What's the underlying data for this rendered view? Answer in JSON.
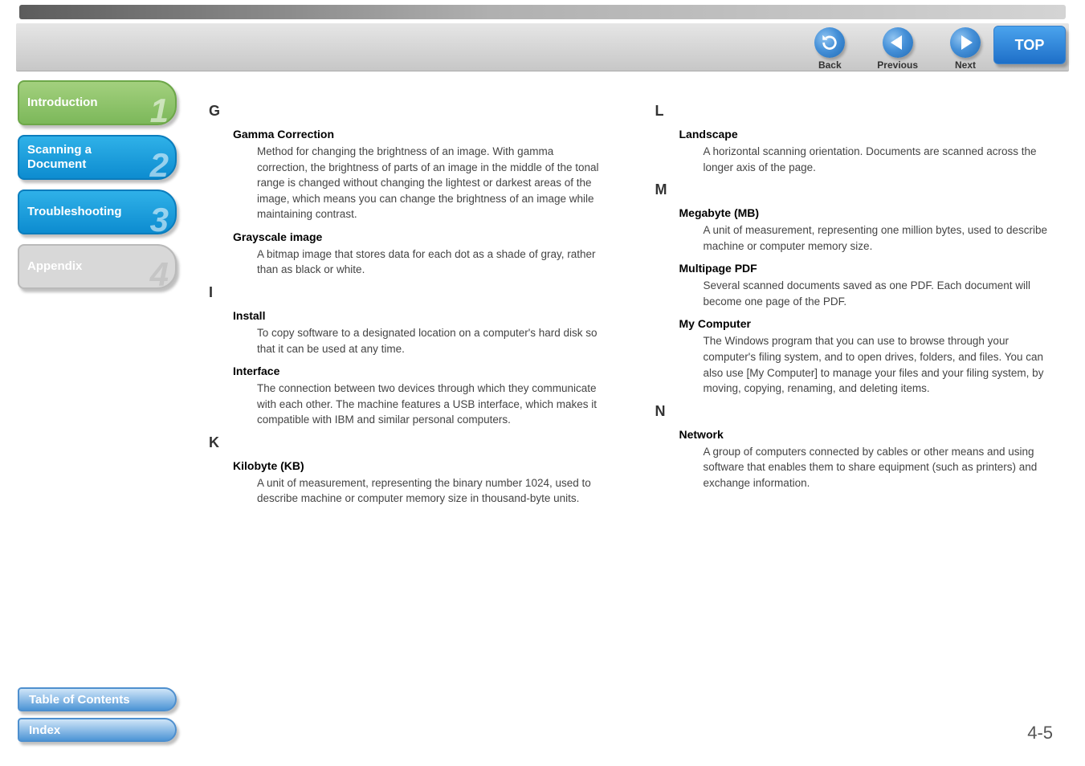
{
  "header": {
    "back_label": "Back",
    "previous_label": "Previous",
    "next_label": "Next",
    "top_label": "TOP"
  },
  "sidebar": {
    "items": [
      {
        "label": "Introduction",
        "num": "1"
      },
      {
        "label": "Scanning a\nDocument",
        "num": "2"
      },
      {
        "label": "Troubleshooting",
        "num": "3"
      },
      {
        "label": "Appendix",
        "num": "4"
      }
    ],
    "bottom": [
      {
        "label": "Table of Contents"
      },
      {
        "label": "Index"
      }
    ]
  },
  "glossary": {
    "left": [
      {
        "letter": "G",
        "entries": [
          {
            "term": "Gamma Correction",
            "def": "Method for changing the brightness of an image. With gamma correction, the brightness of parts of an image in the middle of the tonal range is changed without changing the lightest or darkest areas of the image, which means you can change the brightness of an image while maintaining contrast."
          },
          {
            "term": "Grayscale image",
            "def": "A bitmap image that stores data for each dot as a shade of gray, rather than as black or white."
          }
        ]
      },
      {
        "letter": "I",
        "entries": [
          {
            "term": "Install",
            "def": "To copy software to a designated location on a computer's hard disk so that it can be used at any time."
          },
          {
            "term": "Interface",
            "def": "The connection between two devices through which they communicate with each other. The machine features a USB interface, which makes it compatible with IBM and similar personal computers."
          }
        ]
      },
      {
        "letter": "K",
        "entries": [
          {
            "term": "Kilobyte (KB)",
            "def": "A unit of measurement, representing the binary number 1024, used to describe machine or computer memory size in thousand-byte units."
          }
        ]
      }
    ],
    "right": [
      {
        "letter": "L",
        "entries": [
          {
            "term": "Landscape",
            "def": "A horizontal scanning orientation. Documents are scanned across the longer axis of the page."
          }
        ]
      },
      {
        "letter": "M",
        "entries": [
          {
            "term": "Megabyte (MB)",
            "def": "A unit of measurement, representing one million bytes, used to describe machine or computer memory size."
          },
          {
            "term": "Multipage PDF",
            "def": "Several scanned documents saved as one PDF. Each document will become one page of the PDF."
          },
          {
            "term": "My Computer",
            "def": "The Windows program that you can use to browse through your computer's filing system, and to open drives, folders, and files. You can also use [My Computer] to manage your files and your filing system, by moving, copying, renaming, and deleting items."
          }
        ]
      },
      {
        "letter": "N",
        "entries": [
          {
            "term": "Network",
            "def": "A group of computers connected by cables or other means and using software that enables them to share equipment (such as printers) and exchange information."
          }
        ]
      }
    ]
  },
  "page_number": "4-5"
}
